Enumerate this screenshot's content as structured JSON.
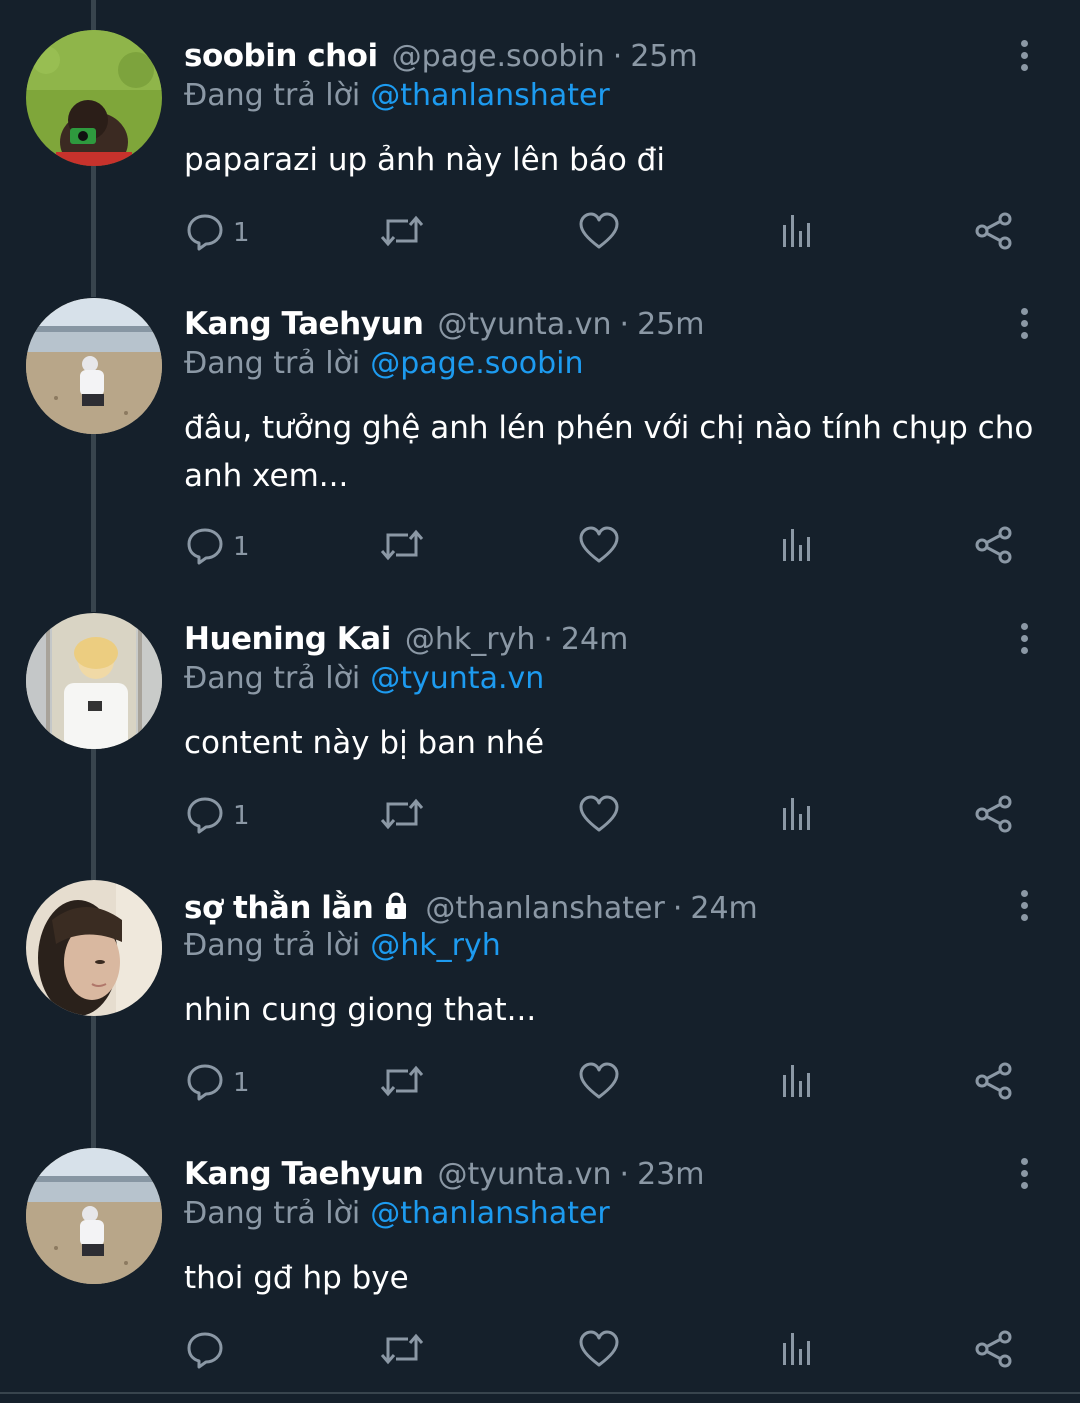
{
  "colors": {
    "background": "#15202b",
    "secondary_text": "#8b98a5",
    "mention": "#1d9bf0",
    "thread_line": "#38444d"
  },
  "replying_label": "Đang trả lời",
  "tweets": [
    {
      "name": "soobin choi",
      "handle": "@page.soobin",
      "separator": "·",
      "time": "25m",
      "reply_to": "@thanlanshater",
      "text": "paparazi up ảnh này lên báo đi",
      "reply_count": "1",
      "locked": false
    },
    {
      "name": "Kang Taehyun",
      "handle": "@tyunta.vn",
      "separator": "·",
      "time": "25m",
      "reply_to": "@page.soobin",
      "text": "đâu, tưởng ghệ anh lén phén với chị nào tính chụp cho anh xem...",
      "reply_count": "1",
      "locked": false
    },
    {
      "name": "Huening Kai",
      "handle": "@hk_ryh",
      "separator": "·",
      "time": "24m",
      "reply_to": "@tyunta.vn",
      "text": "content này bị ban nhé",
      "reply_count": "1",
      "locked": false
    },
    {
      "name": "sợ thằn lằn",
      "handle": "@thanlanshater",
      "separator": "·",
      "time": "24m",
      "reply_to": "@hk_ryh",
      "text": "nhin cung giong that...",
      "reply_count": "1",
      "locked": true
    },
    {
      "name": "Kang Taehyun",
      "handle": "@tyunta.vn",
      "separator": "·",
      "time": "23m",
      "reply_to": "@thanlanshater",
      "text": "thoi gđ hp bye",
      "reply_count": "",
      "locked": false
    }
  ],
  "icons": {
    "reply": "reply-icon",
    "retweet": "retweet-icon",
    "like": "heart-icon",
    "views": "analytics-icon",
    "share": "share-icon",
    "more": "more-vertical-icon",
    "lock": "lock-icon"
  }
}
